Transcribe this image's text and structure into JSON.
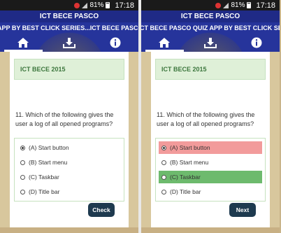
{
  "status": {
    "battery": "81%",
    "time": "17:18"
  },
  "app": {
    "title": "ICT BECE PASCO",
    "ticker_left": "APP BY BEST CLICK SERIES...ICT BECE PASCO QUI",
    "ticker_right": "CT BECE PASCO QUIZ APP BY BEST CLICK SERIES...I"
  },
  "quiz": {
    "topic": "ICT BECE 2015",
    "question": "11. Which of the following gives the user a log of all opened programs?",
    "options": [
      "(A) Start button",
      "(B) Start menu",
      "(C) Taskbar",
      "(D) Title bar"
    ],
    "selected_index": 0,
    "correct_index": 2,
    "check_label": "Check",
    "next_label": "Next"
  },
  "colors": {
    "titlebar": "#1f2a86",
    "toolbar": "#26349b",
    "wrong": "#f29b9b",
    "correct": "#6dba6d",
    "button": "#1e3a4f"
  }
}
